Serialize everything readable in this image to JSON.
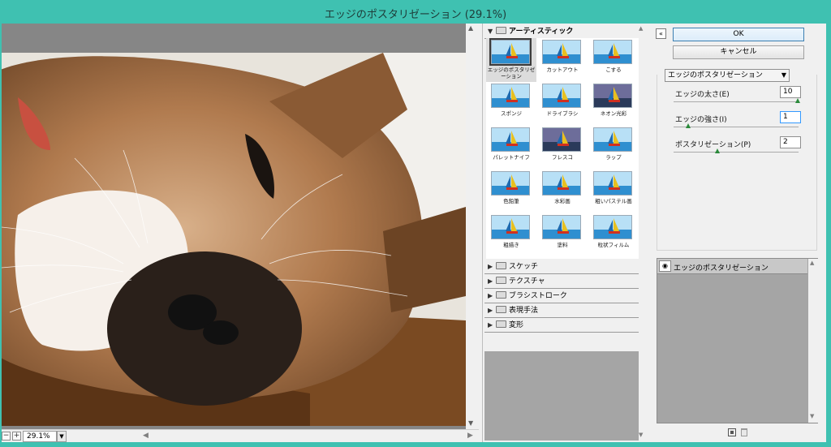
{
  "window": {
    "title": "エッジのポスタリゼーション (29.1%)"
  },
  "preview": {
    "zoom": "29.1%",
    "zoom_out": "−",
    "zoom_in": "+"
  },
  "gallery": {
    "artistic_group": "アーティスティック",
    "filters": [
      "エッジのポスタリゼーション",
      "カットアウト",
      "こする",
      "スポンジ",
      "ドライブラシ",
      "ネオン光彩",
      "パレットナイフ",
      "フレスコ",
      "ラップ",
      "色鉛筆",
      "水彩画",
      "粗いパステル画",
      "粗描き",
      "塗料",
      "粒状フィルム"
    ],
    "groups": [
      "スケッチ",
      "テクスチャ",
      "ブラシストローク",
      "表現手法",
      "変形"
    ]
  },
  "settings": {
    "ok": "OK",
    "cancel": "キャンセル",
    "selected_filter": "エッジのポスタリゼーション",
    "params": [
      {
        "label": "エッジの太さ(E)",
        "value": "10",
        "fraction": 1.0
      },
      {
        "label": "エッジの強さ(I)",
        "value": "1",
        "fraction": 0.1
      },
      {
        "label": "ポスタリゼーション(P)",
        "value": "2",
        "fraction": 0.34
      }
    ],
    "layer": "エッジのポスタリゼーション"
  },
  "colors": {
    "title_bar": "#3fc1b1",
    "ok_border": "#3c7fb1",
    "slider_thumb": "#2a8a3a"
  }
}
